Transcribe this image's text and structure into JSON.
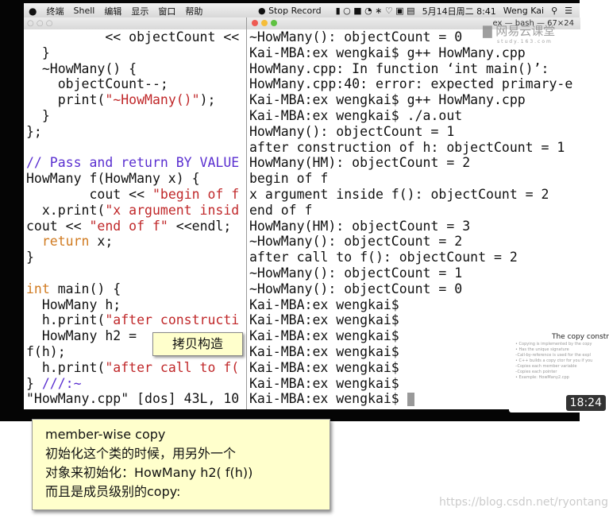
{
  "menubar": {
    "items": [
      "终端",
      "Shell",
      "编辑",
      "显示",
      "窗口",
      "帮助"
    ],
    "record": "Stop Record",
    "datetime": "5月14日周二 8:41",
    "user": "Weng Kai"
  },
  "vim": {
    "lines": [
      [
        [
          "          << objectCount <<",
          ""
        ]
      ],
      [
        [
          "  }",
          ""
        ]
      ],
      [
        [
          "  ~HowMany() {",
          ""
        ]
      ],
      [
        [
          "    objectCount--;",
          ""
        ]
      ],
      [
        [
          "    print(",
          ""
        ],
        [
          "\"~HowMany()\"",
          "str"
        ],
        [
          ");",
          ""
        ]
      ],
      [
        [
          "  }",
          ""
        ]
      ],
      [
        [
          "};",
          ""
        ]
      ],
      [
        [
          "",
          ""
        ]
      ],
      [
        [
          "// Pass and return BY VALUE",
          "cmt"
        ]
      ],
      [
        [
          "HowMany f(HowMany x) {",
          ""
        ]
      ],
      [
        [
          "        cout << ",
          ""
        ],
        [
          "\"begin of f",
          "str"
        ]
      ],
      [
        [
          "  x.print(",
          ""
        ],
        [
          "\"x argument insid",
          "str"
        ]
      ],
      [
        [
          "cout << ",
          ""
        ],
        [
          "\"end of f\"",
          "str"
        ],
        [
          " <<endl;",
          ""
        ]
      ],
      [
        [
          "  ",
          ""
        ],
        [
          "return",
          "kw"
        ],
        [
          " x;",
          ""
        ]
      ],
      [
        [
          "}",
          ""
        ]
      ],
      [
        [
          "",
          ""
        ]
      ],
      [
        [
          "int",
          "kw"
        ],
        [
          " main() {",
          ""
        ]
      ],
      [
        [
          "  HowMany h;",
          ""
        ]
      ],
      [
        [
          "  h.print(",
          ""
        ],
        [
          "\"after constructi",
          "str"
        ]
      ],
      [
        [
          "  HowMany h2 = ",
          ""
        ]
      ],
      [
        [
          "f(h);",
          ""
        ]
      ],
      [
        [
          "  h.print(",
          ""
        ],
        [
          "\"after call to f(",
          "str"
        ]
      ],
      [
        [
          "} ",
          ""
        ],
        [
          "///:~",
          "cmt"
        ]
      ],
      [
        [
          "\"HowMany.cpp\" [dos] 43L, 10",
          ""
        ]
      ]
    ]
  },
  "terminal": {
    "title": "ex — bash — 67×24",
    "lines": [
      "~HowMany(): objectCount = 0",
      "Kai-MBA:ex wengkai$ g++ HowMany.cpp",
      "HowMany.cpp: In function ‘int main()’:",
      "HowMany.cpp:40: error: expected primary-e",
      "Kai-MBA:ex wengkai$ g++ HowMany.cpp",
      "Kai-MBA:ex wengkai$ ./a.out",
      "HowMany(): objectCount = 1",
      "after construction of h: objectCount = 1",
      "HowMany(HM): objectCount = 2",
      "begin of f",
      "x argument inside f(): objectCount = 2",
      "end of f",
      "HowMany(HM): objectCount = 3",
      "~HowMany(): objectCount = 2",
      "after call to f(): objectCount = 2",
      "~HowMany(): objectCount = 1",
      "~HowMany(): objectCount = 0",
      "Kai-MBA:ex wengkai$",
      "Kai-MBA:ex wengkai$",
      "Kai-MBA:ex wengkai$",
      "Kai-MBA:ex wengkai$",
      "Kai-MBA:ex wengkai$",
      "Kai-MBA:ex wengkai$",
      "Kai-MBA:ex wengkai$ "
    ]
  },
  "logo": {
    "name": "网易云课堂",
    "sub": "study.163.com"
  },
  "tooltip": "拷贝构造",
  "thumbnail": {
    "title": "The copy constr",
    "bullets": [
      "• Copying is implemented by the copy",
      "• Has the unique signature",
      "–Call-by-reference is used for the expl",
      "• C++ builds a copy ctor for you if you",
      "–Copies each member variable",
      "–Copies each pointer",
      "• Example: HowMany2.cpp"
    ],
    "duration": "18:24"
  },
  "note": {
    "lines": [
      "member-wise    copy",
      "初始化这个类的时候，用另外一个",
      "对象来初始化：HowMany    h2(    f(h))",
      "而且是成员级别的copy:"
    ]
  },
  "watermark": "https://blog.csdn.net/ryontang",
  "colors": {
    "string": "#c0282a",
    "keyword": "#d07a1f",
    "comment": "#5a2fd0",
    "note_bg": "#ffffcc"
  }
}
